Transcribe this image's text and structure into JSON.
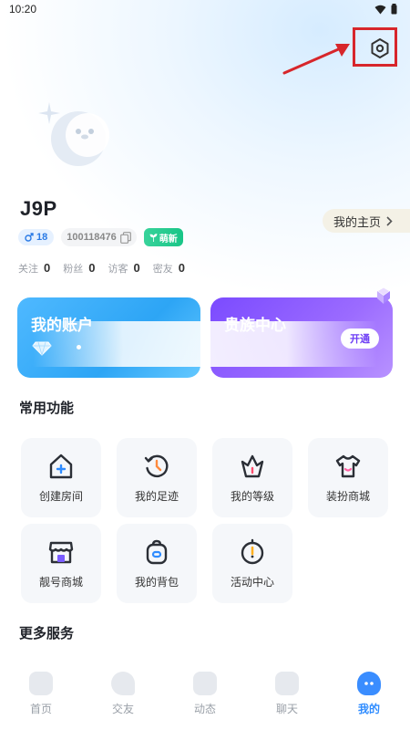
{
  "status_bar": {
    "time": "10:20"
  },
  "profile": {
    "username": "J9P",
    "homepage_label": "我的主页",
    "gender_level": "18",
    "user_id": "100118476",
    "tag": "萌新"
  },
  "stats": [
    {
      "label": "关注",
      "value": "0"
    },
    {
      "label": "粉丝",
      "value": "0"
    },
    {
      "label": "访客",
      "value": "0"
    },
    {
      "label": "密友",
      "value": "0"
    }
  ],
  "cards": {
    "account_title": "我的账户",
    "noble_title": "贵族中心",
    "open_label": "开通"
  },
  "sections": {
    "common": "常用功能",
    "more": "更多服务"
  },
  "features": [
    {
      "label": "创建房间",
      "icon": "house-plus-icon"
    },
    {
      "label": "我的足迹",
      "icon": "history-icon"
    },
    {
      "label": "我的等级",
      "icon": "crown-level-icon"
    },
    {
      "label": "装扮商城",
      "icon": "tshirt-icon"
    },
    {
      "label": "靓号商城",
      "icon": "store-icon"
    },
    {
      "label": "我的背包",
      "icon": "backpack-icon"
    },
    {
      "label": "活动中心",
      "icon": "compass-icon"
    }
  ],
  "tabs": [
    {
      "label": "首页"
    },
    {
      "label": "交友"
    },
    {
      "label": "动态"
    },
    {
      "label": "聊天"
    },
    {
      "label": "我的"
    }
  ],
  "colors": {
    "accent_blue": "#2f8cff",
    "account_card": "#2da5f5",
    "noble_card": "#7b4bff",
    "annotation_red": "#d7262b"
  }
}
